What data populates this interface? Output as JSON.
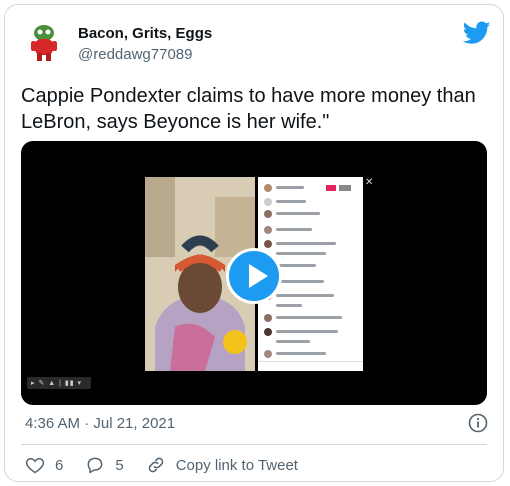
{
  "author": {
    "name": "Bacon, Grits, Eggs",
    "handle": "@reddawg77089"
  },
  "tweet": {
    "text": "Cappie Pondexter claims to have more money than LeBron, says Beyonce is her wife.\"",
    "timestamp": "4:36 AM · Jul 21, 2021"
  },
  "actions": {
    "likes": "6",
    "replies": "5",
    "copy_link": "Copy link to Tweet"
  },
  "icons": {
    "brand": "twitter-bird-icon",
    "info": "info-icon",
    "like": "heart-icon",
    "reply": "reply-icon",
    "link": "link-icon",
    "play": "play-icon"
  },
  "colors": {
    "accent": "#1d9bf0",
    "text_primary": "#0f1419",
    "text_secondary": "#536471",
    "border": "#cfd9de"
  }
}
